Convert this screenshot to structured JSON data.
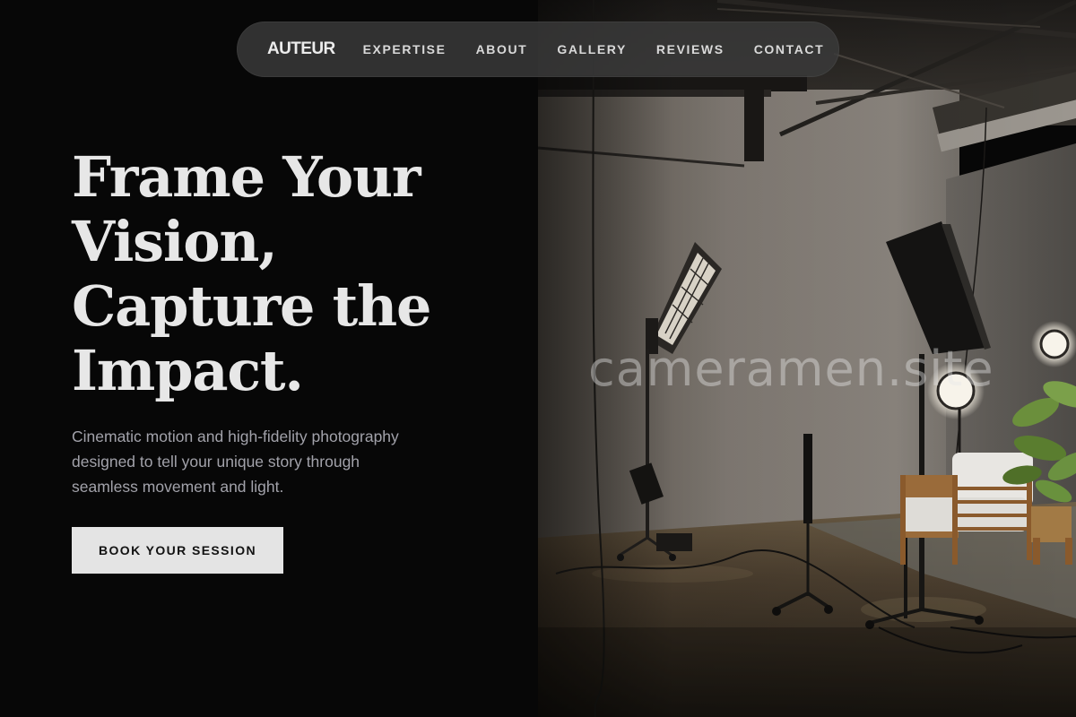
{
  "nav": {
    "brand": "AUTEUR",
    "links": [
      "EXPERTISE",
      "ABOUT",
      "GALLERY",
      "REVIEWS",
      "CONTACT"
    ]
  },
  "hero": {
    "title_lines": [
      "Frame Your",
      "Vision,",
      "Capture the",
      "Impact."
    ],
    "subtitle_lines": [
      "Cinematic motion and high-fidelity photography",
      "designed to tell your unique story through",
      "seamless movement and light."
    ],
    "cta_label": "BOOK YOUR SESSION"
  },
  "image": {
    "subject": "photo-studio-lighting-setup"
  },
  "watermark": "cameramen.site",
  "colors": {
    "background": "#070707",
    "nav_bg": "#3a3a3a",
    "heading": "#e7e7e7",
    "subtitle": "#a2a2aa",
    "cta_bg": "#e4e4e4",
    "cta_text": "#121212"
  }
}
